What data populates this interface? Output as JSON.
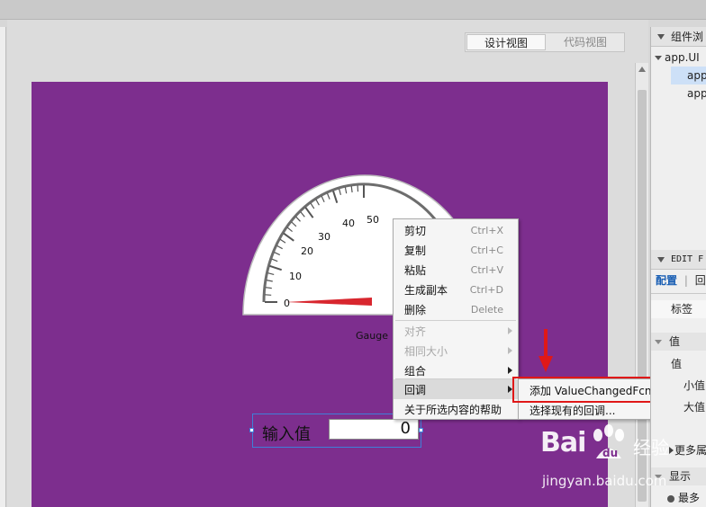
{
  "view_toggle": {
    "design": "设计视图",
    "code": "代码视图"
  },
  "gauge": {
    "label": "Gauge",
    "ticks": [
      "0",
      "10",
      "20",
      "30",
      "40",
      "50"
    ],
    "value": 0
  },
  "context_menu": {
    "cut": {
      "label": "剪切",
      "shortcut": "Ctrl+X"
    },
    "copy": {
      "label": "复制",
      "shortcut": "Ctrl+C"
    },
    "paste": {
      "label": "粘贴",
      "shortcut": "Ctrl+V"
    },
    "duplicate": {
      "label": "生成副本",
      "shortcut": "Ctrl+D"
    },
    "delete": {
      "label": "删除",
      "shortcut": "Delete"
    },
    "align": {
      "label": "对齐"
    },
    "same_size": {
      "label": "相同大小"
    },
    "group": {
      "label": "组合"
    },
    "callback": {
      "label": "回调"
    },
    "help": {
      "label": "关于所选内容的帮助"
    }
  },
  "submenu": {
    "add_callback": "添加 ValueChangedFcn 回调",
    "select_existing": "选择现有的回调..."
  },
  "input_widget": {
    "label": "输入值",
    "value": "0"
  },
  "right_panel": {
    "browser_header": "组件浏",
    "tree_root": "app.UI",
    "tree_child_1": "app",
    "tree_child_2": "app",
    "edit_header": "EDIT F",
    "tab_config": "配置",
    "tab_callback": "回",
    "row_label": "标签",
    "section_value": "值",
    "row_value": "值",
    "row_min": "小值",
    "row_max": "大值",
    "more": "更多属",
    "section_display": "显示",
    "row_last": "最多"
  },
  "watermark": {
    "logo": "Bai",
    "logo_cn": "经验",
    "url": "jingyan.baidu.com"
  },
  "colors": {
    "canvas": "#7d2e8e",
    "highlight_box": "#e01818",
    "selection": "#3f7fd8"
  }
}
